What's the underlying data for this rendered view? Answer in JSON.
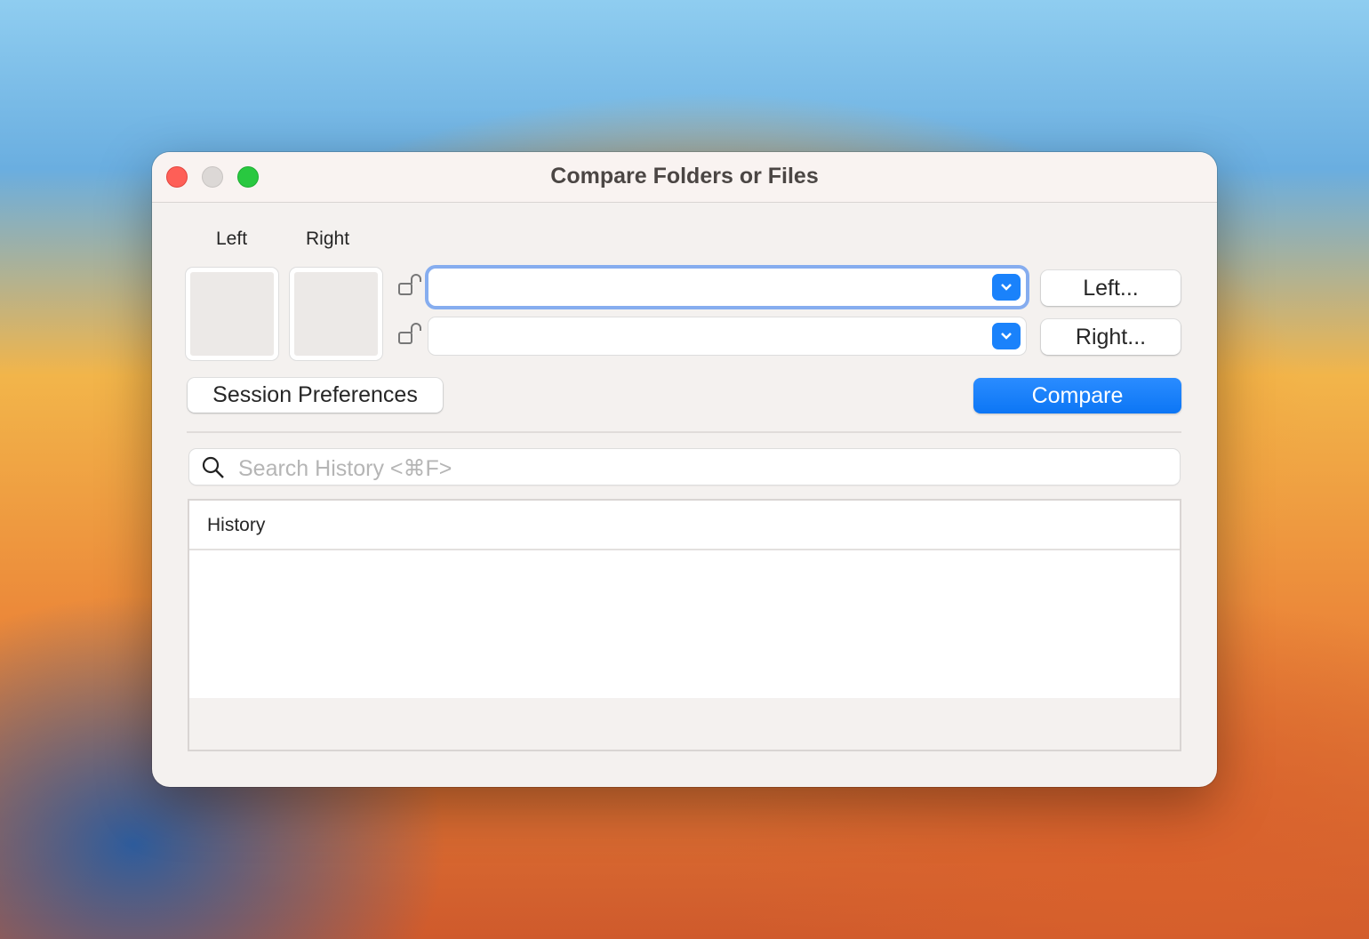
{
  "window": {
    "title": "Compare Folders or Files"
  },
  "labels": {
    "left": "Left",
    "right": "Right"
  },
  "inputs": {
    "left_value": "",
    "right_value": ""
  },
  "buttons": {
    "left": "Left...",
    "right": "Right...",
    "session_prefs": "Session Preferences",
    "compare": "Compare"
  },
  "search": {
    "placeholder": "Search History <⌘F>"
  },
  "history": {
    "header": "History",
    "items": []
  },
  "colors": {
    "accent": "#1a82fb",
    "close": "#fe5f57",
    "minimize": "#dcd8d6",
    "zoom": "#29c840"
  }
}
